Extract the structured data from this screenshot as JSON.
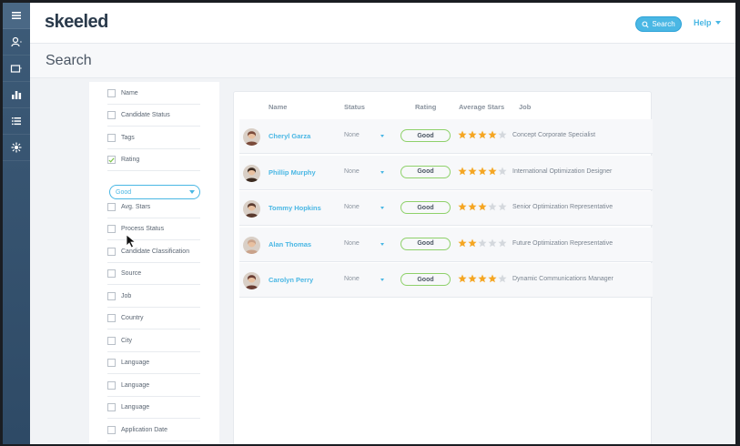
{
  "app": {
    "logo": "skeeled"
  },
  "header": {
    "search_label": "Search",
    "help_label": "Help"
  },
  "page": {
    "title": "Search"
  },
  "rail": {
    "icons": [
      "menu-icon",
      "user-icon",
      "folder-icon",
      "chart-icon",
      "list-icon",
      "sparkle-icon"
    ]
  },
  "filters": {
    "items": [
      {
        "label": "Name",
        "checked": false
      },
      {
        "label": "Candidate Status",
        "checked": false
      },
      {
        "label": "Tags",
        "checked": false
      },
      {
        "label": "Rating",
        "checked": true
      },
      {
        "label": "Avg. Stars",
        "checked": false
      },
      {
        "label": "Process Status",
        "checked": false
      },
      {
        "label": "Candidate Classification",
        "checked": false
      },
      {
        "label": "Source",
        "checked": false
      },
      {
        "label": "Job",
        "checked": false
      },
      {
        "label": "Country",
        "checked": false
      },
      {
        "label": "City",
        "checked": false
      },
      {
        "label": "Language",
        "checked": false
      },
      {
        "label": "Language",
        "checked": false
      },
      {
        "label": "Language",
        "checked": false
      },
      {
        "label": "Application Date",
        "checked": false
      }
    ],
    "rating_select_value": "Good"
  },
  "table": {
    "columns": [
      "Name",
      "Status",
      "Rating",
      "Average Stars",
      "Job"
    ],
    "rows": [
      {
        "name": "Cheryl Garza",
        "status": "None",
        "rating": "Good",
        "stars": 4,
        "job": "Concept Corporate Specialist"
      },
      {
        "name": "Phillip Murphy",
        "status": "None",
        "rating": "Good",
        "stars": 4,
        "job": "International Optimization Designer"
      },
      {
        "name": "Tommy Hopkins",
        "status": "None",
        "rating": "Good",
        "stars": 3,
        "job": "Senior Optimization Representative"
      },
      {
        "name": "Alan Thomas",
        "status": "None",
        "rating": "Good",
        "stars": 2,
        "job": "Future Optimization Representative"
      },
      {
        "name": "Carolyn Perry",
        "status": "None",
        "rating": "Good",
        "stars": 4,
        "job": "Dynamic Communications Manager"
      }
    ],
    "max_stars": 5
  },
  "colors": {
    "accent": "#4ab7e4",
    "rail": "#3d5b78",
    "star_on": "#f5a623",
    "star_off": "#d4d8dd",
    "rating_border": "#8fd16b",
    "avatars": [
      "#7a4a3a",
      "#3b2a20",
      "#5a3a2e",
      "#c9a28a",
      "#6a3d33"
    ]
  }
}
